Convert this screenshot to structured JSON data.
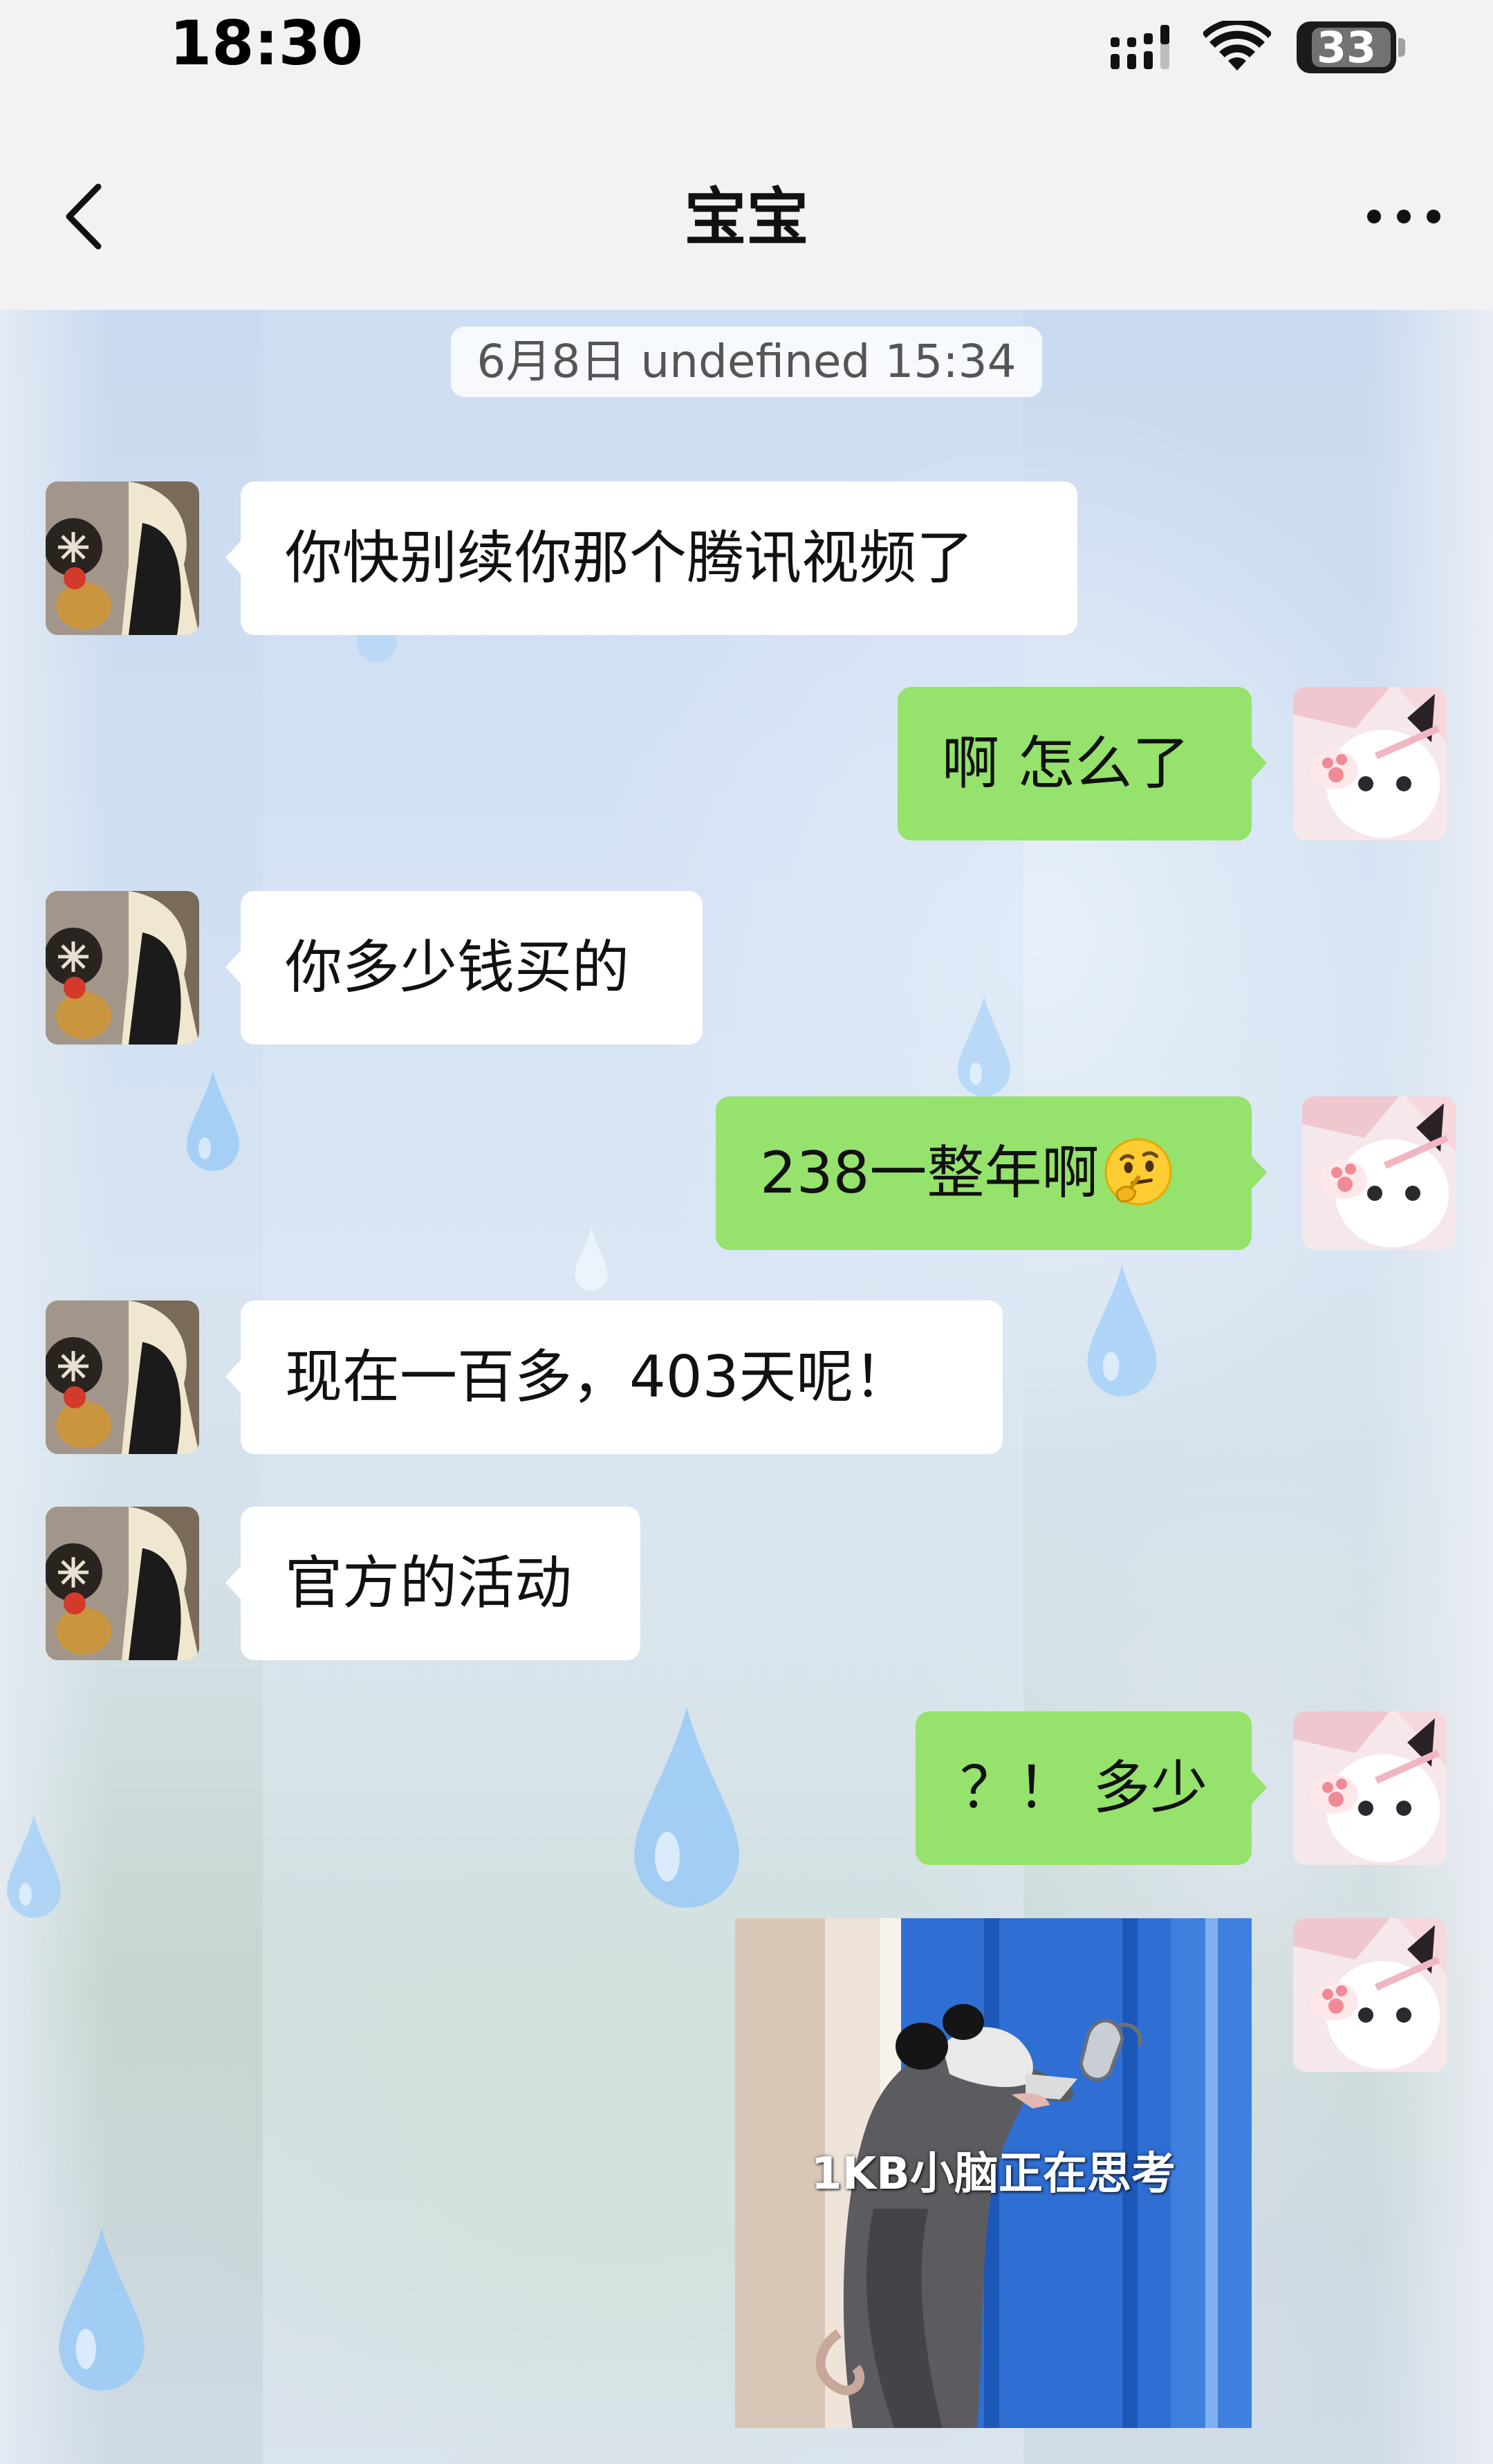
{
  "status_bar": {
    "time": "18:30",
    "battery_level": "33",
    "icons": [
      "signal-icon",
      "wifi-icon",
      "battery-icon"
    ]
  },
  "nav": {
    "title": "宝宝",
    "back_icon": "chevron-left-icon",
    "more_icon": "more-dots-icon"
  },
  "chat": {
    "timestamp": "6月8日 undefined 15:34",
    "messages": [
      {
        "sender": "other",
        "text": "你快别续你那个腾讯视频了"
      },
      {
        "sender": "self",
        "text": "啊 怎么了"
      },
      {
        "sender": "other",
        "text": "你多少钱买的"
      },
      {
        "sender": "self",
        "text": "238一整年啊",
        "emoji": "thinking-face-emoji"
      },
      {
        "sender": "other",
        "text": "现在一百多，403天呢！"
      },
      {
        "sender": "other",
        "text": "官方的活动"
      },
      {
        "sender": "self",
        "text": "？！ 多少"
      },
      {
        "sender": "self",
        "type": "image",
        "caption": "1KB小脑正在思考"
      }
    ]
  },
  "colors": {
    "self_bubble": "#95e26c",
    "other_bubble": "#ffffff",
    "bar_background": "#f2f2f4"
  }
}
